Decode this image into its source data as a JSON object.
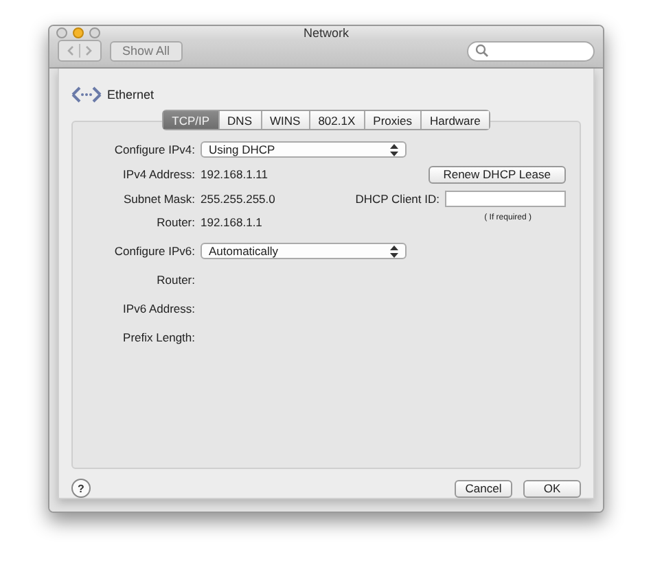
{
  "window": {
    "title": "Network"
  },
  "toolbar": {
    "show_all": "Show All"
  },
  "service": {
    "name": "Ethernet"
  },
  "tabs": [
    {
      "label": "TCP/IP",
      "selected": true
    },
    {
      "label": "DNS",
      "selected": false
    },
    {
      "label": "WINS",
      "selected": false
    },
    {
      "label": "802.1X",
      "selected": false
    },
    {
      "label": "Proxies",
      "selected": false
    },
    {
      "label": "Hardware",
      "selected": false
    }
  ],
  "ipv4": {
    "configure_label": "Configure IPv4:",
    "configure_value": "Using DHCP",
    "fields": [
      {
        "label": "IPv4 Address:",
        "value": "192.168.1.11"
      },
      {
        "label": "Subnet Mask:",
        "value": "255.255.255.0"
      },
      {
        "label": "Router:",
        "value": "192.168.1.1"
      }
    ],
    "renew_button": "Renew DHCP Lease",
    "client_id_label": "DHCP Client ID:",
    "client_id_hint": "( If required )"
  },
  "ipv6": {
    "configure_label": "Configure IPv6:",
    "configure_value": "Automatically",
    "fields": [
      {
        "label": "Router:"
      },
      {
        "label": "IPv6 Address:"
      },
      {
        "label": "Prefix Length:"
      }
    ]
  },
  "buttons": {
    "help": "?",
    "cancel": "Cancel",
    "ok": "OK"
  }
}
